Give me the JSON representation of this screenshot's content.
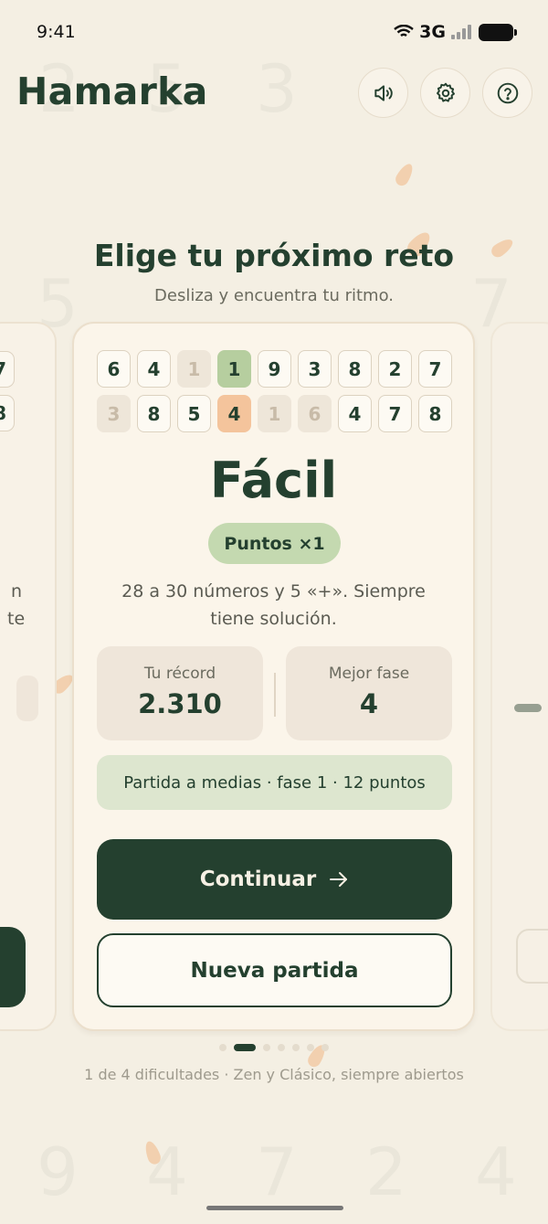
{
  "status": {
    "time": "9:41",
    "network": "3G"
  },
  "header": {
    "title": "Hamarka",
    "sound_icon": "speaker-icon",
    "settings_icon": "gear-icon",
    "help_icon": "question-icon"
  },
  "intro": {
    "headline": "Elige tu próximo reto",
    "subheadline": "Desliza y encuentra tu ritmo."
  },
  "left_card": {
    "tiles": [
      "7",
      "8"
    ],
    "fragments": [
      "n",
      "te"
    ]
  },
  "card": {
    "tiles": [
      {
        "v": "6",
        "s": "normal"
      },
      {
        "v": "4",
        "s": "normal"
      },
      {
        "v": "1",
        "s": "dim"
      },
      {
        "v": "1",
        "s": "green"
      },
      {
        "v": "9",
        "s": "normal"
      },
      {
        "v": "3",
        "s": "normal"
      },
      {
        "v": "8",
        "s": "normal"
      },
      {
        "v": "2",
        "s": "normal"
      },
      {
        "v": "7",
        "s": "normal"
      },
      {
        "v": "3",
        "s": "dim"
      },
      {
        "v": "8",
        "s": "normal"
      },
      {
        "v": "5",
        "s": "normal"
      },
      {
        "v": "4",
        "s": "orange"
      },
      {
        "v": "1",
        "s": "dim"
      },
      {
        "v": "6",
        "s": "dim"
      },
      {
        "v": "4",
        "s": "normal"
      },
      {
        "v": "7",
        "s": "normal"
      },
      {
        "v": "8",
        "s": "normal"
      }
    ],
    "level": "Fácil",
    "multiplier": "Puntos ×1",
    "description": "28 a 30 números y 5 «+». Siempre tiene solución.",
    "stats": {
      "record_label": "Tu récord",
      "record_value": "2.310",
      "best_phase_label": "Mejor fase",
      "best_phase_value": "4"
    },
    "in_progress": "Partida a medias · fase 1 · 12 puntos",
    "continue_label": "Continuar",
    "continue_icon": "arrow-right-icon",
    "new_game_label": "Nueva partida"
  },
  "pager": {
    "total_dots": 7,
    "active_index": 1
  },
  "footer_note": "1 de 4 dificultades · Zen y Clásico, siempre abiertos",
  "colors": {
    "accent": "#24402f",
    "background": "#f4efe3",
    "tile_green": "#b6ce9f",
    "tile_orange": "#f4c49c"
  }
}
